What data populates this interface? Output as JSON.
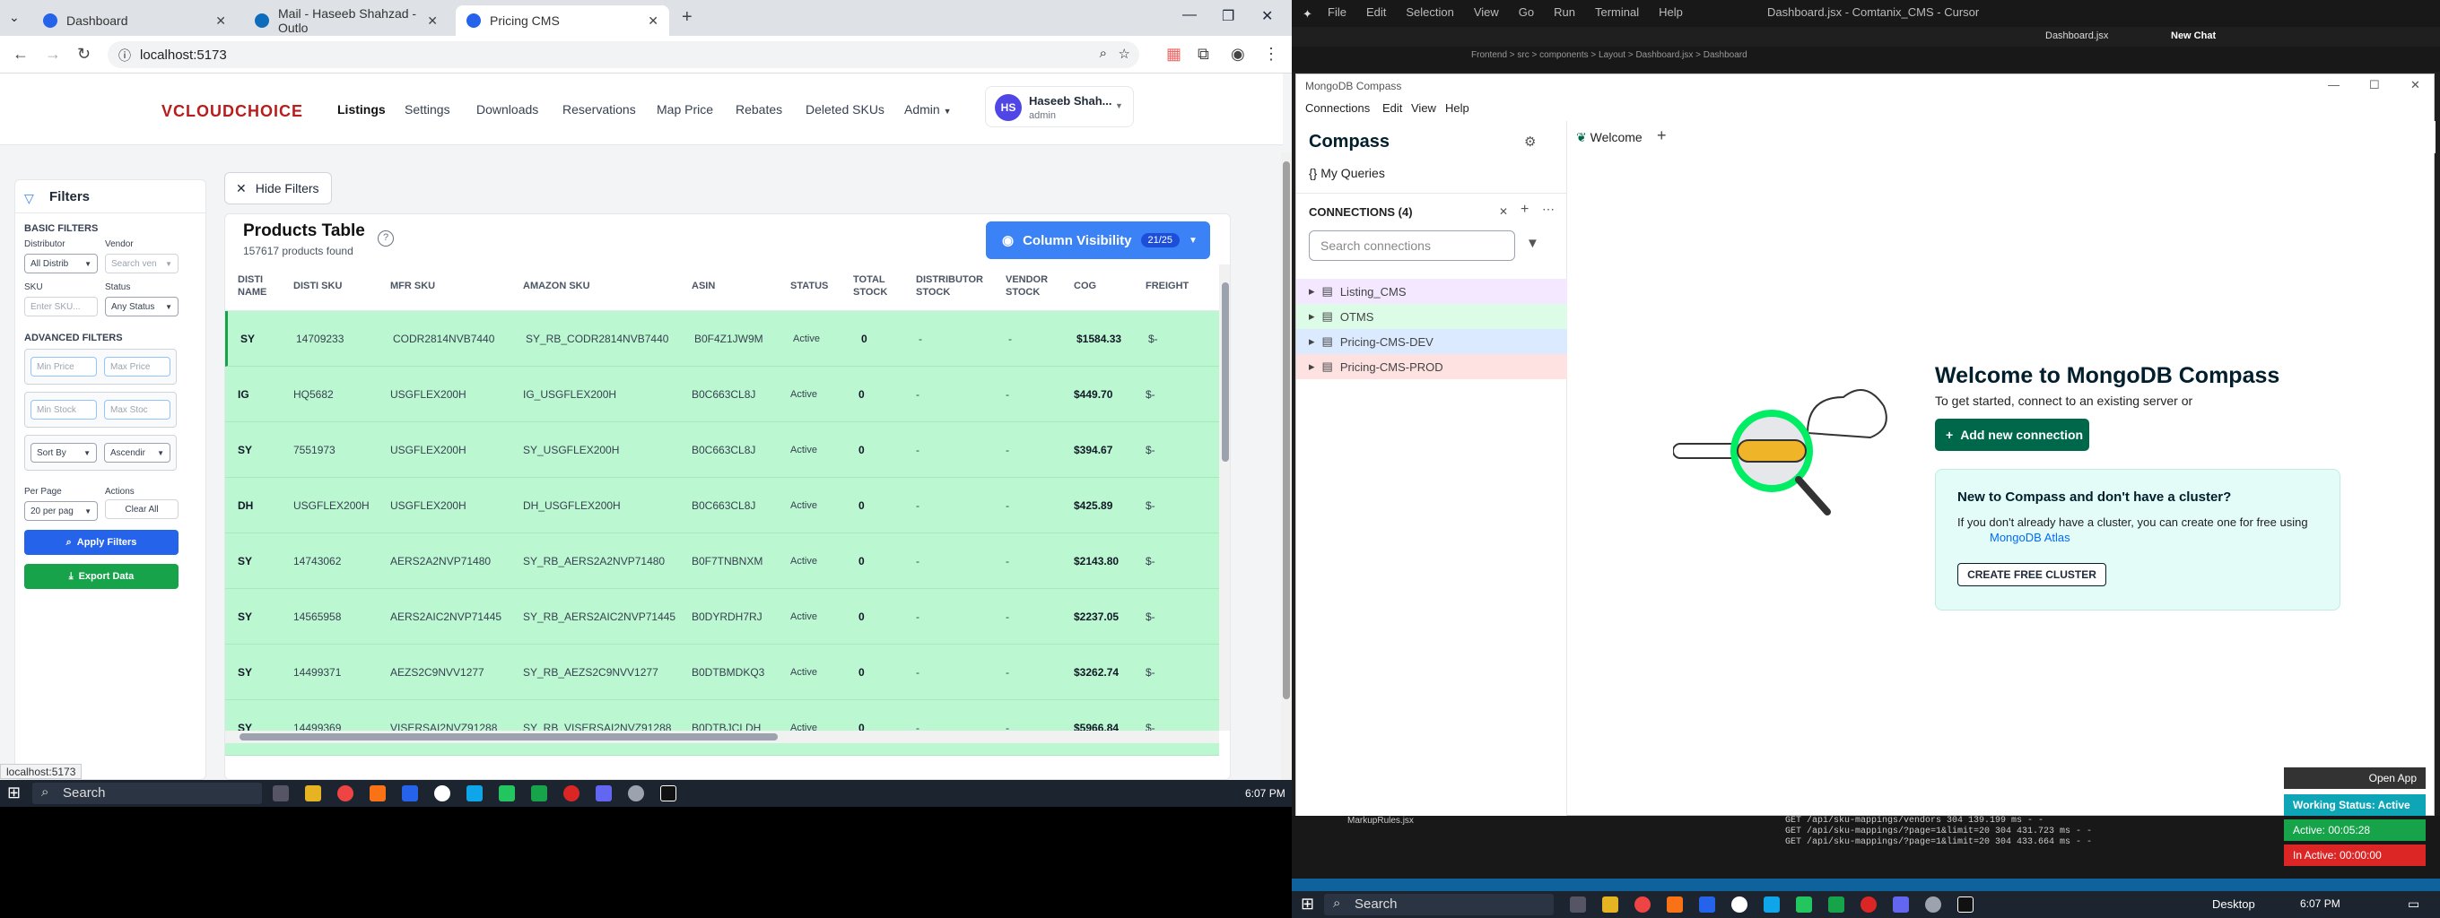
{
  "browser": {
    "tabs": [
      {
        "title": "Dashboard"
      },
      {
        "title": "Mail - Haseeb Shahzad - Outlo"
      },
      {
        "title": "Pricing CMS"
      }
    ],
    "url": "localhost:5173",
    "status_url": "localhost:5173"
  },
  "app": {
    "logo": "VCLOUDCHOICE",
    "nav": [
      "Listings",
      "Settings",
      "Downloads",
      "Reservations",
      "Map Price",
      "Rebates",
      "Deleted SKUs",
      "Admin"
    ],
    "user": {
      "initials": "HS",
      "name": "Haseeb Shah...",
      "role": "admin"
    }
  },
  "filters": {
    "title": "Filters",
    "basic": "BASIC FILTERS",
    "distributor_label": "Distributor",
    "distributor_value": "All Distrib",
    "vendor_label": "Vendor",
    "vendor_placeholder": "Search ven",
    "sku_label": "SKU",
    "sku_placeholder": "Enter SKU...",
    "status_label": "Status",
    "status_value": "Any Status",
    "advanced": "ADVANCED FILTERS",
    "min_price": "Min Price",
    "max_price": "Max Price",
    "min_stock": "Min Stock",
    "max_stock": "Max Stoc",
    "sort_by": "Sort By",
    "order": "Ascendir",
    "per_page_label": "Per Page",
    "per_page_value": "20 per pag",
    "actions_label": "Actions",
    "clear_all": "Clear All",
    "apply": "Apply Filters",
    "export": "Export Data"
  },
  "hide_filters": "Hide Filters",
  "table": {
    "title": "Products Table",
    "count": "157617 products found",
    "column_visibility": "Column Visibility",
    "column_badge": "21/25",
    "headers": [
      "DISTI NAME",
      "DISTI SKU",
      "MFR SKU",
      "AMAZON SKU",
      "ASIN",
      "STATUS",
      "TOTAL STOCK",
      "DISTRIBUTOR STOCK",
      "VENDOR STOCK",
      "COG",
      "FREIGHT"
    ],
    "rows": [
      [
        "SY",
        "14709233",
        "CODR2814NVB7440",
        "SY_RB_CODR2814NVB7440",
        "B0F4Z1JW9M",
        "Active",
        "0",
        "-",
        "-",
        "$1584.33",
        "$-"
      ],
      [
        "IG",
        "HQ5682",
        "USGFLEX200H",
        "IG_USGFLEX200H",
        "B0C663CL8J",
        "Active",
        "0",
        "-",
        "-",
        "$449.70",
        "$-"
      ],
      [
        "SY",
        "7551973",
        "USGFLEX200H",
        "SY_USGFLEX200H",
        "B0C663CL8J",
        "Active",
        "0",
        "-",
        "-",
        "$394.67",
        "$-"
      ],
      [
        "DH",
        "USGFLEX200H",
        "USGFLEX200H",
        "DH_USGFLEX200H",
        "B0C663CL8J",
        "Active",
        "0",
        "-",
        "-",
        "$425.89",
        "$-"
      ],
      [
        "SY",
        "14743062",
        "AERS2A2NVP71480",
        "SY_RB_AERS2A2NVP71480",
        "B0F7TNBNXM",
        "Active",
        "0",
        "-",
        "-",
        "$2143.80",
        "$-"
      ],
      [
        "SY",
        "14565958",
        "AERS2AIC2NVP71445",
        "SY_RB_AERS2AIC2NVP71445",
        "B0DYRDH7RJ",
        "Active",
        "0",
        "-",
        "-",
        "$2237.05",
        "$-"
      ],
      [
        "SY",
        "14499371",
        "AEZS2C9NVV1277",
        "SY_RB_AEZS2C9NVV1277",
        "B0DTBMDKQ3",
        "Active",
        "0",
        "-",
        "-",
        "$3262.74",
        "$-"
      ],
      [
        "SY",
        "14499369",
        "VISERSAI2NVZ91288",
        "SY_RB_VISERSAI2NVZ91288",
        "B0DTBJCLDH",
        "Active",
        "0",
        "-",
        "-",
        "$5966.84",
        "$-"
      ]
    ]
  },
  "taskbar1": {
    "search": "Search",
    "time": "6:07 PM"
  },
  "cursor": {
    "menu": [
      "File",
      "Edit",
      "Selection",
      "View",
      "Go",
      "Run",
      "Terminal",
      "Help"
    ],
    "title": "Dashboard.jsx - Comtanix_CMS - Cursor",
    "new_chat": "New Chat",
    "breadcrumb": "Frontend > src > components > Layout > Dashboard.jsx > Dashboard",
    "tabs": [
      "Dashboard.jsx"
    ],
    "terminal": [
      "GET /api/sku-mappings/vendors 304 139.199 ms - -",
      "GET /api/sku-mappings/?page=1&limit=20 304 431.723 ms - -",
      "GET /api/sku-mappings/?page=1&limit=20 304 433.664 ms - -"
    ],
    "file": "MarkupRules.jsx"
  },
  "compass": {
    "title": "MongoDB Compass",
    "menu": [
      "Connections",
      "Edit",
      "View",
      "Help"
    ],
    "app": "Compass",
    "my_queries": "My Queries",
    "connections_label": "CONNECTIONS (4)",
    "search_placeholder": "Search connections",
    "connections": [
      {
        "name": "Listing_CMS",
        "color": "#f3e8ff"
      },
      {
        "name": "OTMS",
        "color": "#dcfce7"
      },
      {
        "name": "Pricing-CMS-DEV",
        "color": "#dbeafe"
      },
      {
        "name": "Pricing-CMS-PROD",
        "color": "#fee2e2"
      }
    ],
    "tab": "Welcome",
    "welcome_title": "Welcome to MongoDB Compass",
    "welcome_sub": "To get started, connect to an existing server or",
    "add_connection": "Add new connection",
    "card_title": "New to Compass and don't have a cluster?",
    "card_text": "If you don't already have a cluster, you can create one for free using",
    "atlas": "MongoDB Atlas",
    "create_cluster": "CREATE FREE CLUSTER"
  },
  "widget": {
    "open_app": "Open App",
    "working": "Working Status: Active",
    "active": "Active: 00:05:28",
    "inactive": "In Active: 00:00:00"
  },
  "taskbar2": {
    "search": "Search",
    "desktop": "Desktop",
    "time": "6:07 PM"
  }
}
